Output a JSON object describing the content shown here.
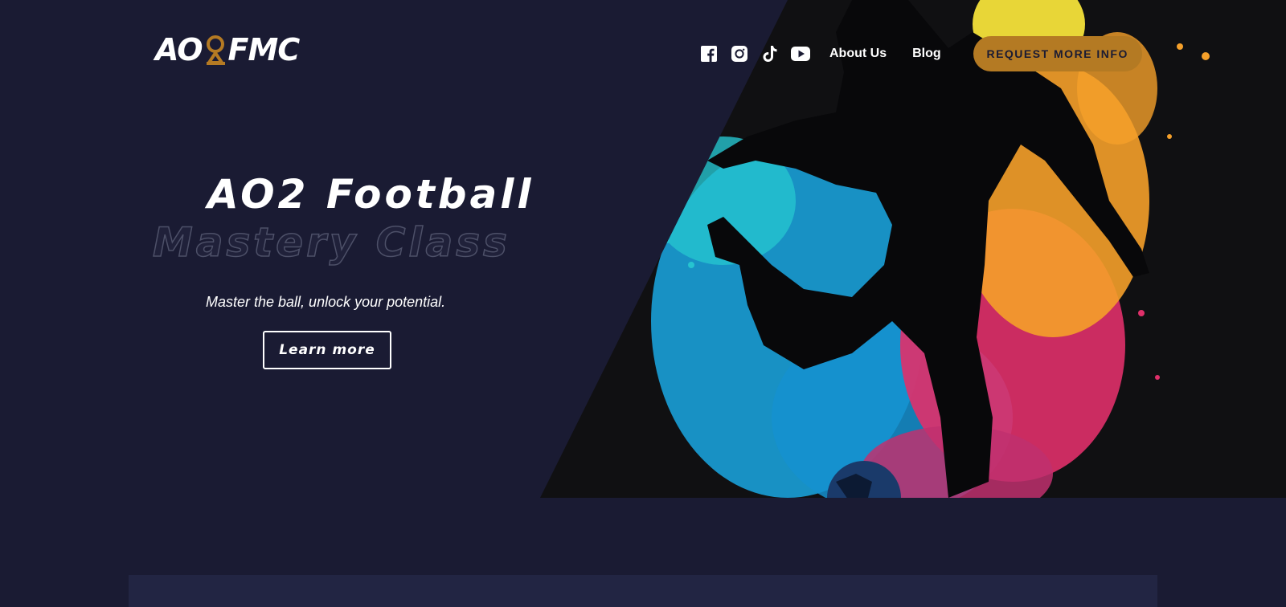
{
  "header": {
    "logo": {
      "prefix": "AO",
      "suffix": "FMC"
    },
    "social": [
      "facebook-icon",
      "instagram-icon",
      "tiktok-icon",
      "youtube-icon"
    ],
    "nav": [
      {
        "label": "About Us"
      },
      {
        "label": "Blog"
      }
    ],
    "cta_label": "REQUEST MORE INFO"
  },
  "hero": {
    "title_line1": "AO2 Football",
    "title_line2": "Mastery Class",
    "tagline": "Master the ball, unlock your potential.",
    "button_label": "Learn more",
    "art": "football-player-splash-illustration"
  },
  "colors": {
    "background": "#1a1b33",
    "accent": "#b47a23",
    "text": "#ffffff",
    "outline_text": "#4d5068",
    "splash_blue": "#1aa0d8",
    "splash_orange": "#f5a02a",
    "splash_pink": "#e0306a",
    "splash_yellow": "#f4e23a"
  }
}
